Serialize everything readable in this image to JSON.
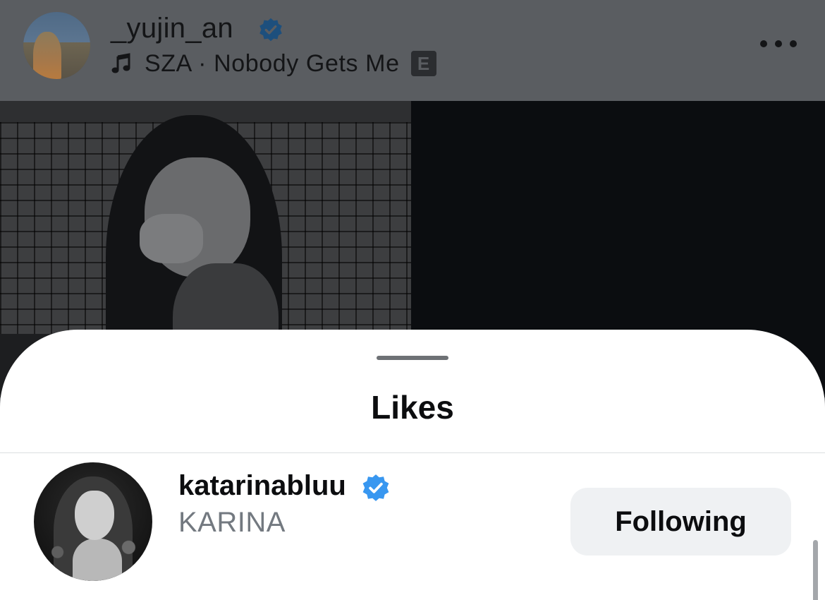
{
  "post": {
    "username": "_yujin_an",
    "verified_icon": "verified-badge-icon",
    "music": {
      "icon": "music-note-icon",
      "track": "SZA · Nobody Gets Me",
      "explicit_label": "E"
    },
    "more_icon": "more-options-icon"
  },
  "sheet": {
    "title": "Likes"
  },
  "likes": [
    {
      "username": "katarinabluu",
      "full_name": "KARINA",
      "verified": true,
      "button_label": "Following"
    }
  ],
  "colors": {
    "verified_blue": "#3897f0",
    "dim_overlay": "#5a5d61",
    "button_bg": "#eff1f3",
    "secondary_text": "#737980"
  }
}
